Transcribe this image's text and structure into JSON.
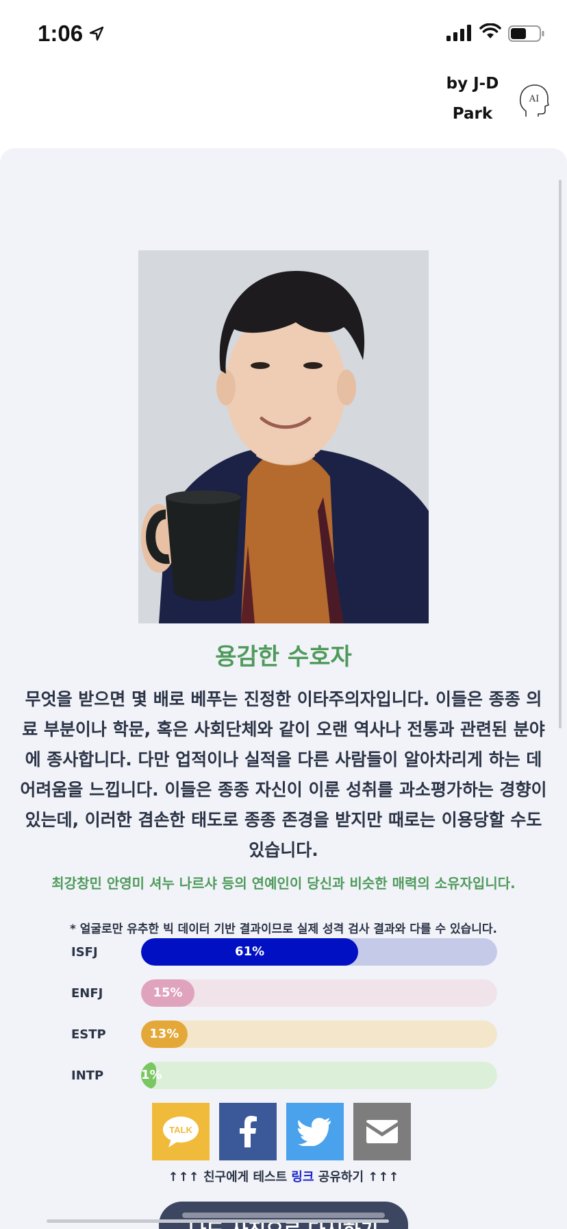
{
  "status_bar": {
    "time": "1:06",
    "battery_level": 0.55
  },
  "header": {
    "brand": "by J-D Park",
    "brand_line1": "by J-D",
    "brand_line2": "Park",
    "ai_icon_text": "AI"
  },
  "result": {
    "type_title": "용감한 수호자",
    "description": "무엇을 받으면 몇 배로 베푸는 진정한 이타주의자입니다. 이들은 종종 의료 부분이나 학문, 혹은 사회단체와 같이 오랜 역사나 전통과 관련된 분야에 종사합니다. 다만 업적이나 실적을 다른 사람들이 알아차리게 하는 데 어려움을 느낍니다. 이들은 종종 자신이 이룬 성취를 과소평가하는 경향이 있는데, 이러한 겸손한 태도로 종종 존경을 받지만 때로는 이용당할 수도 있습니다.",
    "celebrities": "최강창민 안영미 셔누 나르샤 등의 연예인이 당신과 비슷한 매력의 소유자입니다.",
    "disclaimer": "* 얼굴로만 유추한 빅 데이터 기반 결과이므로 실제 성격 검사 결과와 다를 수 있습니다."
  },
  "bars": [
    {
      "label": "ISFJ",
      "percent": 61,
      "text": "61%",
      "fill": "#0010c2",
      "track": "#c5cae9"
    },
    {
      "label": "ENFJ",
      "percent": 15,
      "text": "15%",
      "fill": "#e0a3bd",
      "track": "#f1e3ea"
    },
    {
      "label": "ESTP",
      "percent": 13,
      "text": "13%",
      "fill": "#e3a838",
      "track": "#f3e6cb"
    },
    {
      "label": "INTP",
      "percent": 1,
      "text": "1%",
      "fill": "#7ac661",
      "track": "#dcefd8"
    }
  ],
  "share": {
    "kakao_label": "TALK",
    "kakao_icon": "kakao-talk-icon",
    "facebook_icon": "facebook-icon",
    "twitter_icon": "twitter-icon",
    "email_icon": "email-icon",
    "note_prefix": "↑↑↑ 친구에게 테스트 ",
    "note_link": "링크",
    "note_suffix": " 공유하기 ↑↑↑"
  },
  "retry_button": "나도 사진으로 다시하기",
  "colors": {
    "title_green": "#4f9a5b",
    "card_bg": "#f1f3f8",
    "button_dark": "#3c4660"
  }
}
